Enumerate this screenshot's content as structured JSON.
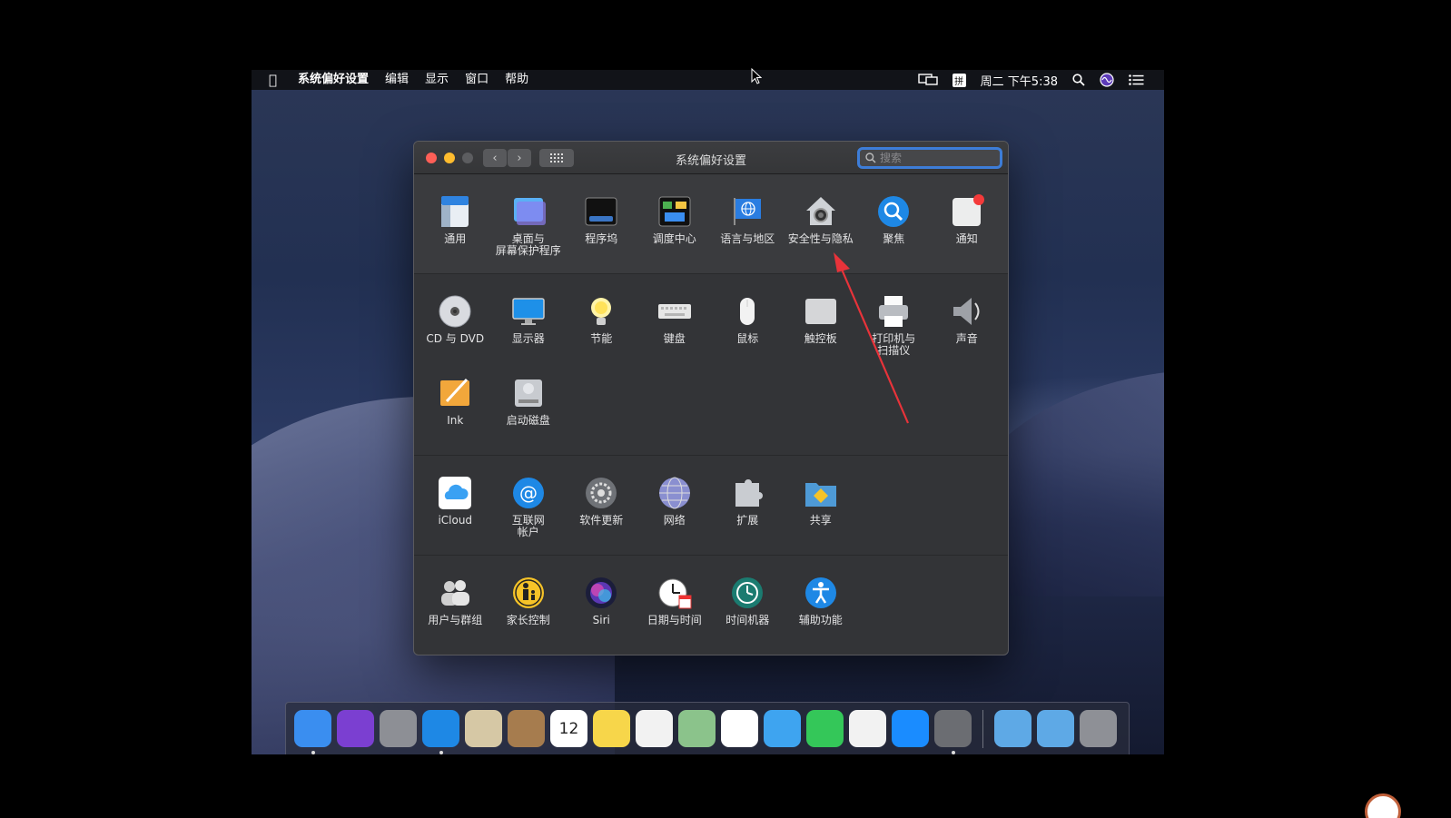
{
  "menubar": {
    "apple": "",
    "app_name": "系统偏好设置",
    "menus": [
      "编辑",
      "显示",
      "窗口",
      "帮助"
    ],
    "ime": "拼",
    "clock": "周二 下午5:38"
  },
  "window": {
    "title": "系统偏好设置",
    "search_placeholder": "搜索",
    "sections": [
      [
        {
          "label": "通用",
          "icon": "general-icon"
        },
        {
          "label": "桌面与\n屏幕保护程序",
          "icon": "desktop-icon"
        },
        {
          "label": "程序坞",
          "icon": "dock-icon"
        },
        {
          "label": "调度中心",
          "icon": "mission-control-icon"
        },
        {
          "label": "语言与地区",
          "icon": "language-icon"
        },
        {
          "label": "安全性与隐私",
          "icon": "security-icon"
        },
        {
          "label": "聚焦",
          "icon": "spotlight-icon"
        },
        {
          "label": "通知",
          "icon": "notifications-icon"
        }
      ],
      [
        {
          "label": "CD 与 DVD",
          "icon": "cd-dvd-icon"
        },
        {
          "label": "显示器",
          "icon": "display-icon"
        },
        {
          "label": "节能",
          "icon": "energy-icon"
        },
        {
          "label": "键盘",
          "icon": "keyboard-icon"
        },
        {
          "label": "鼠标",
          "icon": "mouse-icon"
        },
        {
          "label": "触控板",
          "icon": "trackpad-icon"
        },
        {
          "label": "打印机与\n扫描仪",
          "icon": "printer-icon"
        },
        {
          "label": "声音",
          "icon": "sound-icon"
        },
        {
          "label": "Ink",
          "icon": "ink-icon"
        },
        {
          "label": "启动磁盘",
          "icon": "startup-disk-icon"
        }
      ],
      [
        {
          "label": "iCloud",
          "icon": "icloud-icon"
        },
        {
          "label": "互联网\n帐户",
          "icon": "internet-accounts-icon"
        },
        {
          "label": "软件更新",
          "icon": "software-update-icon"
        },
        {
          "label": "网络",
          "icon": "network-icon"
        },
        {
          "label": "扩展",
          "icon": "extensions-icon"
        },
        {
          "label": "共享",
          "icon": "sharing-icon"
        }
      ],
      [
        {
          "label": "用户与群组",
          "icon": "users-icon"
        },
        {
          "label": "家长控制",
          "icon": "parental-controls-icon"
        },
        {
          "label": "Siri",
          "icon": "siri-icon"
        },
        {
          "label": "日期与时间",
          "icon": "date-time-icon"
        },
        {
          "label": "时间机器",
          "icon": "time-machine-icon"
        },
        {
          "label": "辅助功能",
          "icon": "accessibility-icon"
        }
      ]
    ]
  },
  "dock": {
    "apps": [
      {
        "icon": "finder-icon",
        "running": true,
        "color": "#3a8ef0"
      },
      {
        "icon": "siri-icon",
        "running": false,
        "color": "#7b3fd1"
      },
      {
        "icon": "launchpad-icon",
        "running": false,
        "color": "#8d8f95"
      },
      {
        "icon": "safari-icon",
        "running": true,
        "color": "#1e88e5"
      },
      {
        "icon": "mail-icon",
        "running": false,
        "color": "#d6c8a5"
      },
      {
        "icon": "contacts-icon",
        "running": false,
        "color": "#a67c4e"
      },
      {
        "icon": "calendar-icon",
        "running": false,
        "color": "#ffffff",
        "text": "12"
      },
      {
        "icon": "notes-icon",
        "running": false,
        "color": "#f7d64a"
      },
      {
        "icon": "reminders-icon",
        "running": false,
        "color": "#f2f2f2"
      },
      {
        "icon": "maps-icon",
        "running": false,
        "color": "#8bc38b"
      },
      {
        "icon": "photos-icon",
        "running": false,
        "color": "#ffffff"
      },
      {
        "icon": "messages-icon",
        "running": false,
        "color": "#3ea4f0"
      },
      {
        "icon": "facetime-icon",
        "running": false,
        "color": "#34c759"
      },
      {
        "icon": "itunes-icon",
        "running": false,
        "color": "#f2f2f2"
      },
      {
        "icon": "app-store-icon",
        "running": false,
        "color": "#1a8cff"
      },
      {
        "icon": "system-preferences-icon",
        "running": true,
        "color": "#6b6d72"
      }
    ],
    "others": [
      {
        "icon": "downloads-folder-icon",
        "color": "#5ea9e6"
      },
      {
        "icon": "airdrop-folder-icon",
        "color": "#5ea9e6"
      },
      {
        "icon": "trash-icon",
        "color": "#8e9096"
      }
    ]
  },
  "colors": {
    "accent": "#3d7dd8",
    "annotation_arrow": "#e8333a"
  }
}
